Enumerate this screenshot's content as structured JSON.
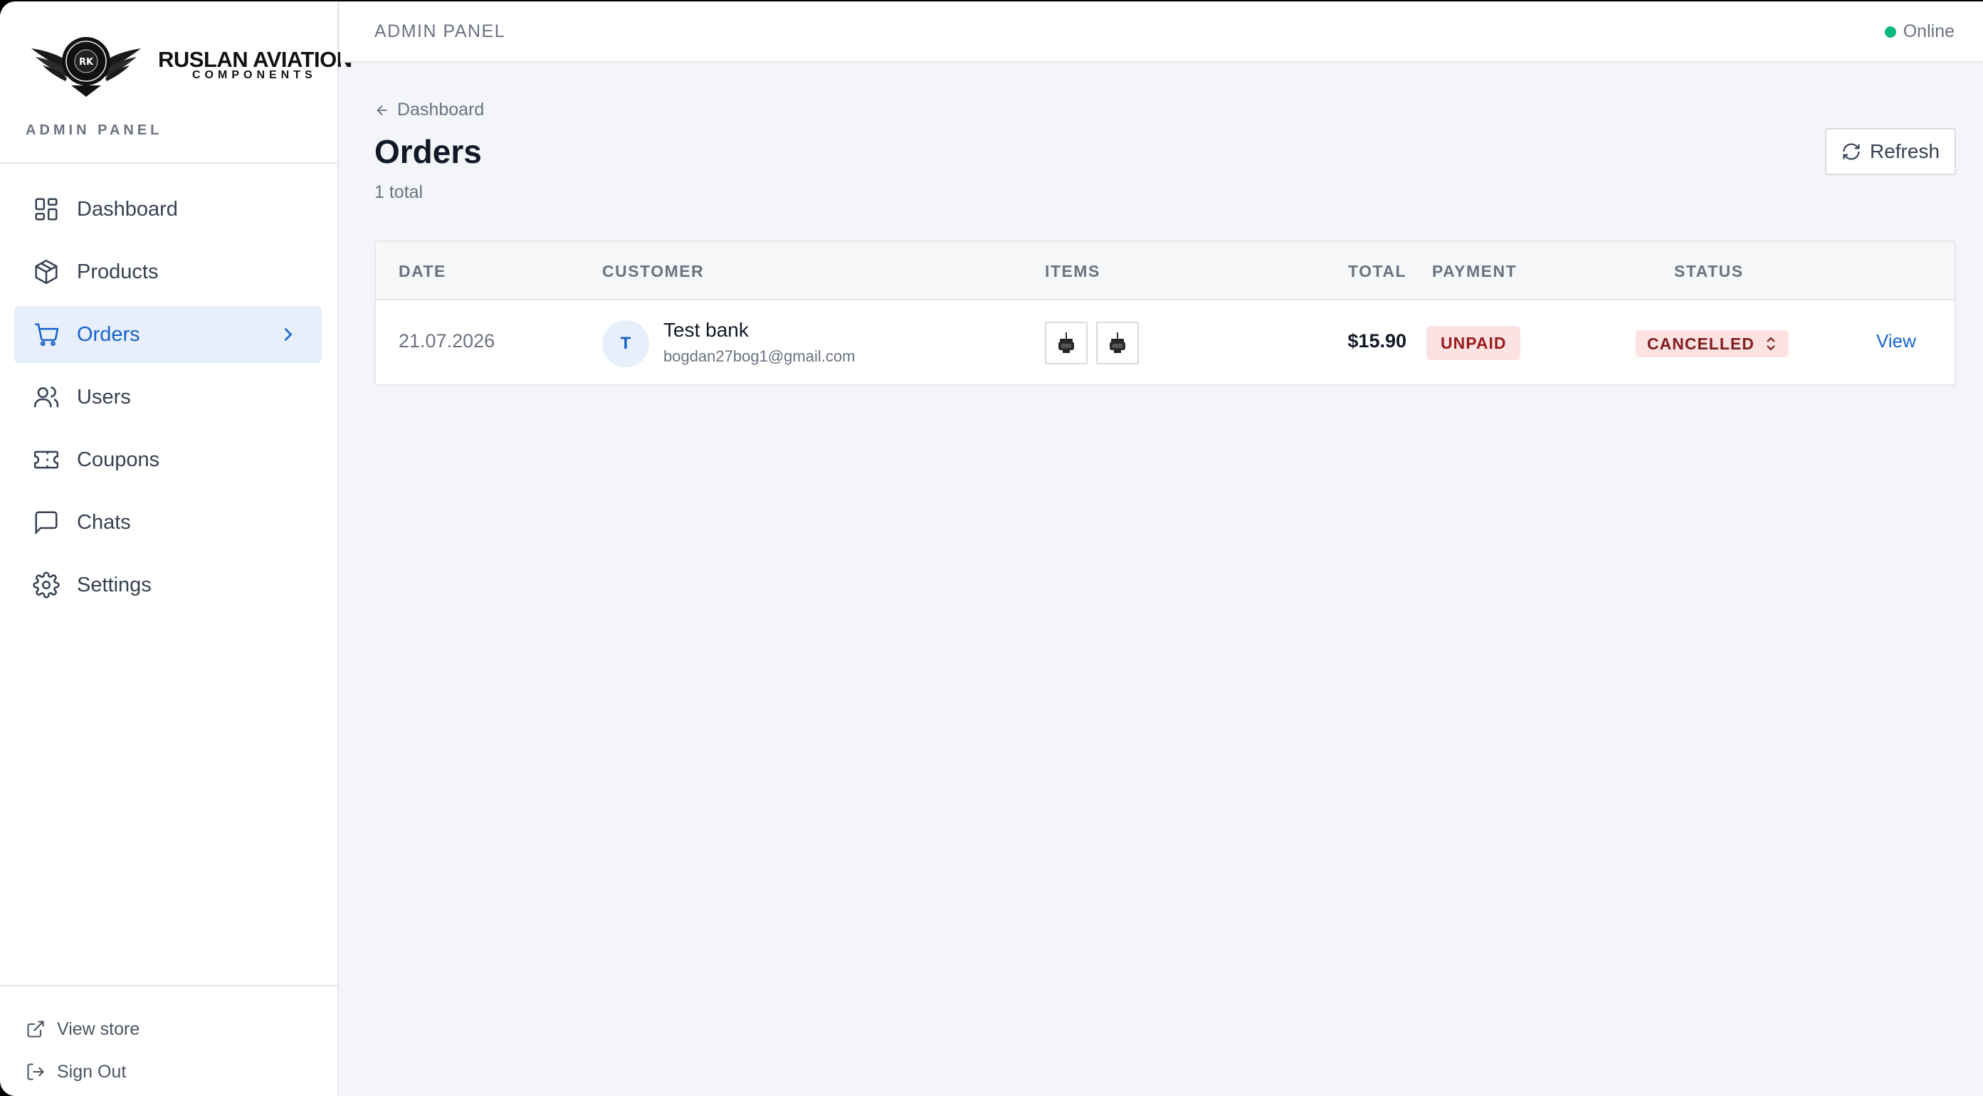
{
  "brand": {
    "name": "RUSLAN AVIATION",
    "subtitle": "COMPONENTS",
    "panel_label": "ADMIN PANEL",
    "emblem_initials": "RK"
  },
  "sidebar": {
    "items": [
      {
        "label": "Dashboard",
        "icon": "dashboard-icon"
      },
      {
        "label": "Products",
        "icon": "package-icon"
      },
      {
        "label": "Orders",
        "icon": "cart-icon",
        "active": true
      },
      {
        "label": "Users",
        "icon": "users-icon"
      },
      {
        "label": "Coupons",
        "icon": "ticket-icon"
      },
      {
        "label": "Chats",
        "icon": "chat-icon"
      },
      {
        "label": "Settings",
        "icon": "gear-icon"
      }
    ],
    "bottom": [
      {
        "label": "View store",
        "icon": "external-link-icon"
      },
      {
        "label": "Sign Out",
        "icon": "sign-out-icon"
      }
    ]
  },
  "topbar": {
    "title": "ADMIN PANEL",
    "status": "Online",
    "status_color": "#10b981"
  },
  "page": {
    "breadcrumb": "Dashboard",
    "title": "Orders",
    "count": "1 total",
    "refresh_label": "Refresh"
  },
  "table": {
    "headers": {
      "date": "DATE",
      "customer": "CUSTOMER",
      "items": "ITEMS",
      "total": "TOTAL",
      "payment": "PAYMENT",
      "status": "STATUS"
    },
    "rows": [
      {
        "date": "21.07.2026",
        "avatar_initial": "T",
        "customer_name": "Test bank",
        "customer_email": "bogdan27bog1@gmail.com",
        "items": [
          "product-thumbnail",
          "product-thumbnail"
        ],
        "total": "$15.90",
        "payment": "UNPAID",
        "status": "CANCELLED",
        "action": "View"
      }
    ]
  },
  "colors": {
    "accent": "#1862c9",
    "danger_bg": "#fde2e2",
    "danger_text": "#991b1b"
  }
}
